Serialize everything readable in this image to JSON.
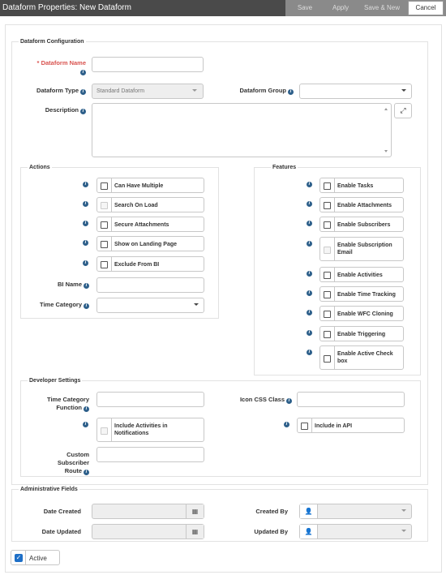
{
  "window": {
    "title": "Dataform Properties: New Dataform"
  },
  "toolbar": {
    "save": "Save",
    "apply": "Apply",
    "save_new": "Save & New",
    "cancel": "Cancel"
  },
  "config": {
    "legend": "Dataform Configuration",
    "name_label": "Dataform Name",
    "type_label": "Dataform Type",
    "type_value": "Standard Dataform",
    "group_label": "Dataform Group",
    "group_value": "",
    "description_label": "Description"
  },
  "actions": {
    "legend": "Actions",
    "items": [
      {
        "label": "Can Have Multiple",
        "checked": false,
        "disabled": false
      },
      {
        "label": "Search On Load",
        "checked": false,
        "disabled": true
      },
      {
        "label": "Secure Attachments",
        "checked": false,
        "disabled": false
      },
      {
        "label": "Show on Landing Page",
        "checked": false,
        "disabled": false
      },
      {
        "label": "Exclude From BI",
        "checked": false,
        "disabled": false
      }
    ],
    "bi_name_label": "BI Name",
    "time_category_label": "Time Category"
  },
  "features": {
    "legend": "Features",
    "items": [
      {
        "label": "Enable Tasks",
        "checked": false,
        "disabled": false
      },
      {
        "label": "Enable Attachments",
        "checked": false,
        "disabled": false
      },
      {
        "label": "Enable Subscribers",
        "checked": false,
        "disabled": false
      },
      {
        "label": "Enable Subscription Email",
        "checked": false,
        "disabled": true
      },
      {
        "label": "Enable Activities",
        "checked": false,
        "disabled": false
      },
      {
        "label": "Enable Time Tracking",
        "checked": false,
        "disabled": false
      },
      {
        "label": "Enable WFC Cloning",
        "checked": false,
        "disabled": false
      },
      {
        "label": "Enable Triggering",
        "checked": false,
        "disabled": false
      },
      {
        "label": "Enable Active Check box",
        "checked": false,
        "disabled": false
      }
    ]
  },
  "developer": {
    "legend": "Developer Settings",
    "time_category_function_label": "Time Category Function",
    "icon_css_class_label": "Icon CSS Class",
    "include_activities_label": "Include Activities in Notifications",
    "include_in_api_label": "Include in API",
    "custom_subscriber_route_label": "Custom Subscriber Route"
  },
  "admin": {
    "legend": "Administrative Fields",
    "date_created_label": "Date Created",
    "date_updated_label": "Date Updated",
    "created_by_label": "Created By",
    "updated_by_label": "Updated By"
  },
  "footer": {
    "active_label": "Active",
    "active_checked": true
  },
  "colors": {
    "titlebar": "#4a4a4a",
    "info_icon": "#2d5f8a",
    "required": "#d9534f",
    "checkbox_checked": "#1e6fc7"
  }
}
